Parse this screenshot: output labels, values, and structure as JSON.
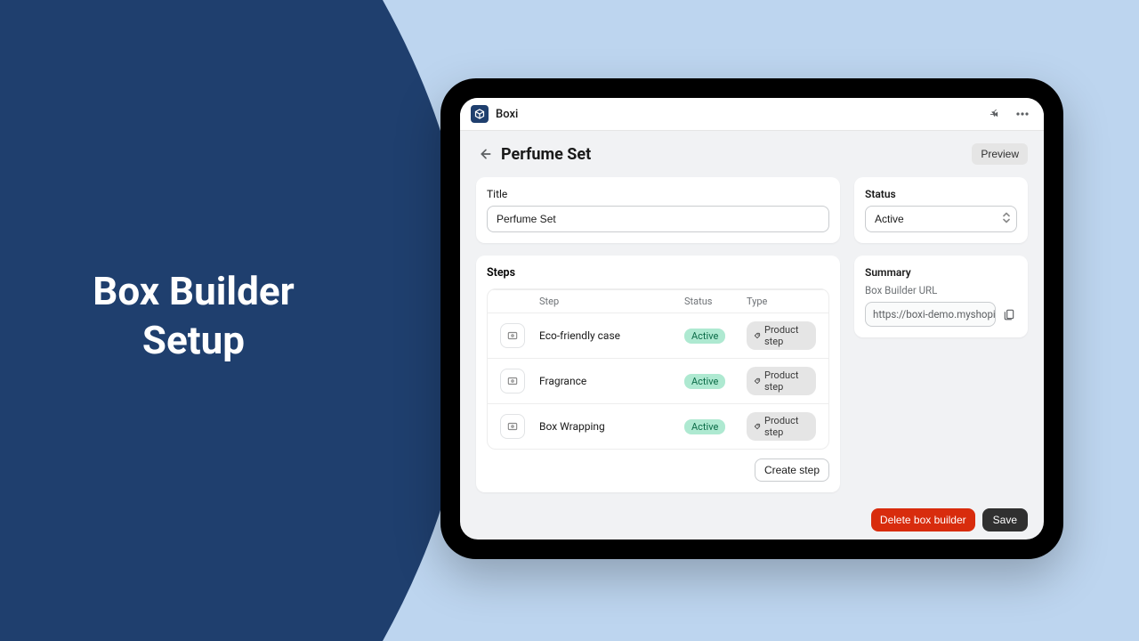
{
  "hero": {
    "title_l1": "Box Builder",
    "title_l2": "Setup"
  },
  "app": {
    "name": "Boxi"
  },
  "page": {
    "title": "Perfume Set",
    "preview_label": "Preview",
    "title_field_label": "Title",
    "title_field_value": "Perfume Set"
  },
  "steps": {
    "section_label": "Steps",
    "columns": {
      "step": "Step",
      "status": "Status",
      "type": "Type"
    },
    "rows": [
      {
        "name": "Eco-friendly case",
        "status": "Active",
        "type": "Product step"
      },
      {
        "name": "Fragrance",
        "status": "Active",
        "type": "Product step"
      },
      {
        "name": "Box Wrapping",
        "status": "Active",
        "type": "Product step"
      }
    ],
    "create_label": "Create step"
  },
  "status": {
    "label": "Status",
    "value": "Active"
  },
  "summary": {
    "label": "Summary",
    "url_label": "Box Builder URL",
    "url_value": "https://boxi-demo.myshopify.c"
  },
  "footer": {
    "delete_label": "Delete box builder",
    "save_label": "Save"
  }
}
